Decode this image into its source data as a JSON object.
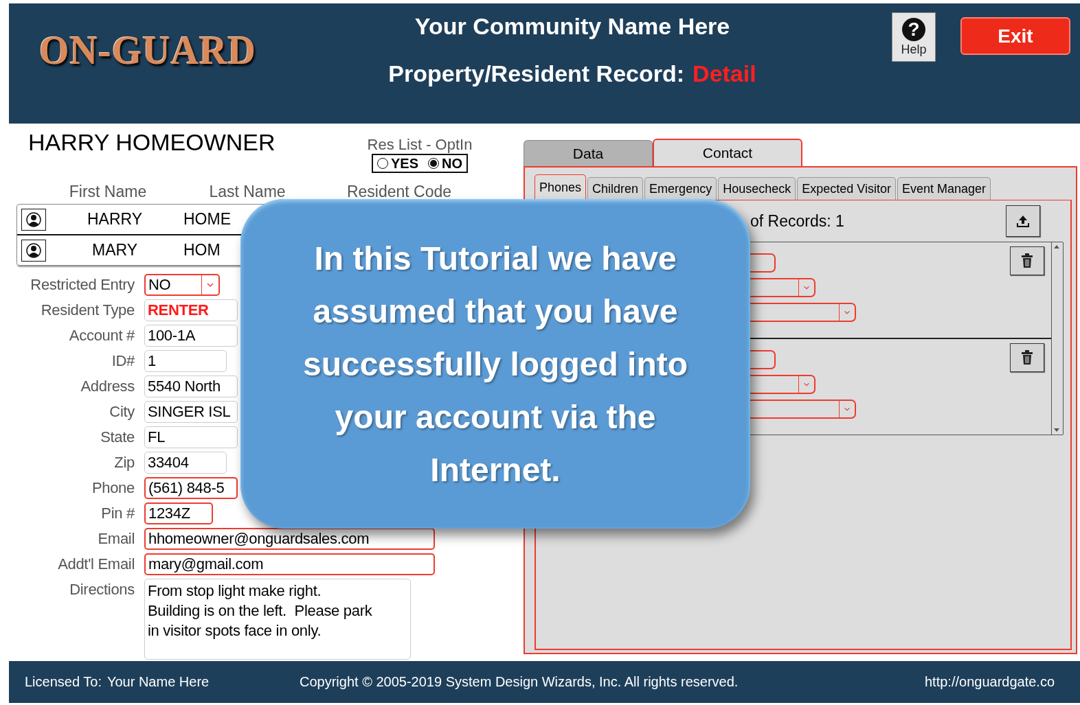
{
  "header": {
    "logo": "ON-GUARD",
    "community": "Your Community Name Here",
    "record_title": "Property/Resident Record:",
    "record_mode": "Detail",
    "help": {
      "icon": "?",
      "label": "Help"
    },
    "exit": "Exit"
  },
  "resident": {
    "name": "HARRY HOMEOWNER",
    "optin": {
      "label": "Res List - OptIn",
      "options": [
        {
          "label": "YES",
          "selected": false
        },
        {
          "label": "NO",
          "selected": true
        }
      ]
    }
  },
  "residents_table": {
    "columns": [
      "First Name",
      "Last Name",
      "Resident Code"
    ],
    "rows": [
      {
        "first": "HARRY",
        "last": "HOME"
      },
      {
        "first": "MARY",
        "last": "HOM"
      }
    ]
  },
  "fields": [
    {
      "label": "Restricted Entry",
      "value": "NO",
      "kind": "select",
      "required": true,
      "emphasis": false
    },
    {
      "label": "Resident Type",
      "value": "RENTER",
      "kind": "text",
      "required": false,
      "emphasis": true
    },
    {
      "label": "Account #",
      "value": "100-1A",
      "kind": "text",
      "required": false,
      "emphasis": false
    },
    {
      "label": "ID#",
      "value": "1",
      "kind": "text",
      "required": false,
      "emphasis": false
    },
    {
      "label": "Address",
      "value": "5540 North",
      "kind": "text",
      "required": false,
      "emphasis": false
    },
    {
      "label": "City",
      "value": "SINGER ISL",
      "kind": "text",
      "required": false,
      "emphasis": false
    },
    {
      "label": "State",
      "value": "FL",
      "kind": "text",
      "required": false,
      "emphasis": false
    },
    {
      "label": "Zip",
      "value": "33404",
      "kind": "text",
      "required": false,
      "emphasis": false
    },
    {
      "label": "Phone",
      "value": "(561) 848-5",
      "kind": "text",
      "required": true,
      "emphasis": false
    },
    {
      "label": "Pin #",
      "value": "1234Z",
      "kind": "text",
      "required": true,
      "emphasis": false
    },
    {
      "label": "Email",
      "value": "hhomeowner@onguardsales.com",
      "kind": "text",
      "required": true,
      "emphasis": false
    },
    {
      "label": "Addt'l Email",
      "value": "mary@gmail.com",
      "kind": "text",
      "required": true,
      "emphasis": false
    },
    {
      "label": "Directions",
      "value": "From stop light make right.\nBuilding is on the left.  Please park\nin visitor spots face in only.",
      "kind": "textarea",
      "required": false,
      "emphasis": false
    }
  ],
  "tabs": [
    {
      "label": "Data",
      "selected": false
    },
    {
      "label": "Contact",
      "selected": true
    }
  ],
  "subtabs": [
    {
      "label": "Phones",
      "selected": true
    },
    {
      "label": "Children",
      "selected": false
    },
    {
      "label": "Emergency",
      "selected": false
    },
    {
      "label": "Housecheck",
      "selected": false
    },
    {
      "label": "Expected Visitor",
      "selected": false
    },
    {
      "label": "Event Manager",
      "selected": false
    }
  ],
  "records_count": "of Records: 1",
  "callout": "In this Tutorial we have assumed that you have successfully logged into your account via the Internet.",
  "footer": {
    "licensed_label": "Licensed To:",
    "licensed_name": "Your Name Here",
    "copyright": "Copyright © 2005-2019 System Design Wizards, Inc. All rights reserved.",
    "url": "http://onguardgate.co"
  }
}
